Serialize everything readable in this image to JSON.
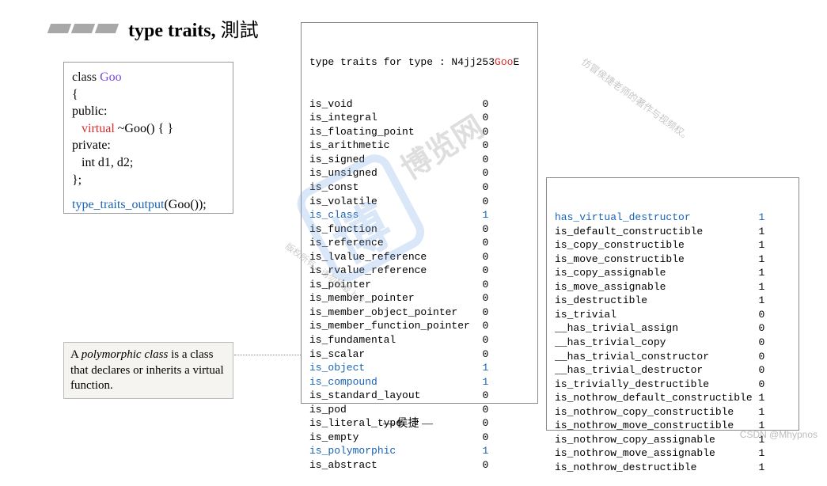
{
  "title": {
    "bold": "type traits,",
    "rest": " 測試"
  },
  "code_left": {
    "l1a": "class ",
    "l1b": "Goo",
    "l2": "{",
    "l3": "public:",
    "l4a": "virtual",
    "l4b": " ~Goo() {    }",
    "l5": "private:",
    "l6": "int d1, d2;",
    "l7": "};",
    "l8a": "type_traits_output",
    "l8b": "(Goo());"
  },
  "note": {
    "t1": "A ",
    "t2": "polymorphic class",
    "t3": " is a class that declares or inherits a virtual function."
  },
  "mid_header_a": "type traits for type : N4jj253",
  "mid_header_b": "Goo",
  "mid_header_c": "E",
  "mid": [
    {
      "k": "is_void",
      "v": "0",
      "hl": ""
    },
    {
      "k": "is_integral",
      "v": "0",
      "hl": ""
    },
    {
      "k": "is_floating_point",
      "v": "0",
      "hl": ""
    },
    {
      "k": "is_arithmetic",
      "v": "0",
      "hl": ""
    },
    {
      "k": "is_signed",
      "v": "0",
      "hl": ""
    },
    {
      "k": "is_unsigned",
      "v": "0",
      "hl": ""
    },
    {
      "k": "is_const",
      "v": "0",
      "hl": ""
    },
    {
      "k": "is_volatile",
      "v": "0",
      "hl": ""
    },
    {
      "k": "is_class",
      "v": "1",
      "hl": "blue"
    },
    {
      "k": "is_function",
      "v": "0",
      "hl": ""
    },
    {
      "k": "is_reference",
      "v": "0",
      "hl": ""
    },
    {
      "k": "is_lvalue_reference",
      "v": "0",
      "hl": ""
    },
    {
      "k": "is_rvalue_reference",
      "v": "0",
      "hl": ""
    },
    {
      "k": "is_pointer",
      "v": "0",
      "hl": ""
    },
    {
      "k": "is_member_pointer",
      "v": "0",
      "hl": ""
    },
    {
      "k": "is_member_object_pointer",
      "v": "0",
      "hl": ""
    },
    {
      "k": "is_member_function_pointer",
      "v": "0",
      "hl": ""
    },
    {
      "k": "is_fundamental",
      "v": "0",
      "hl": ""
    },
    {
      "k": "is_scalar",
      "v": "0",
      "hl": ""
    },
    {
      "k": "is_object",
      "v": "1",
      "hl": "blue"
    },
    {
      "k": "is_compound",
      "v": "1",
      "hl": "blue"
    },
    {
      "k": "is_standard_layout",
      "v": "0",
      "hl": ""
    },
    {
      "k": "is_pod",
      "v": "0",
      "hl": ""
    },
    {
      "k": "is_literal_type",
      "v": "0",
      "hl": ""
    },
    {
      "k": "is_empty",
      "v": "0",
      "hl": ""
    },
    {
      "k": "is_polymorphic",
      "v": "1",
      "hl": "blue"
    },
    {
      "k": "is_abstract",
      "v": "0",
      "hl": ""
    }
  ],
  "right": [
    {
      "k": "has_virtual_destructor",
      "v": "1",
      "hl": "blue"
    },
    {
      "k": "is_default_constructible",
      "v": "1",
      "hl": ""
    },
    {
      "k": "is_copy_constructible",
      "v": "1",
      "hl": ""
    },
    {
      "k": "is_move_constructible",
      "v": "1",
      "hl": ""
    },
    {
      "k": "is_copy_assignable",
      "v": "1",
      "hl": ""
    },
    {
      "k": "is_move_assignable",
      "v": "1",
      "hl": ""
    },
    {
      "k": "is_destructible",
      "v": "1",
      "hl": ""
    },
    {
      "k": "is_trivial",
      "v": "0",
      "hl": ""
    },
    {
      "k": "__has_trivial_assign",
      "v": "0",
      "hl": ""
    },
    {
      "k": "__has_trivial_copy",
      "v": "0",
      "hl": ""
    },
    {
      "k": "__has_trivial_constructor",
      "v": "0",
      "hl": ""
    },
    {
      "k": "__has_trivial_destructor",
      "v": "0",
      "hl": ""
    },
    {
      "k": "is_trivially_destructible",
      "v": "0",
      "hl": ""
    },
    {
      "k": "is_nothrow_default_constructible",
      "v": "1",
      "hl": ""
    },
    {
      "k": "is_nothrow_copy_constructible",
      "v": "1",
      "hl": ""
    },
    {
      "k": "is_nothrow_move_constructible",
      "v": "1",
      "hl": ""
    },
    {
      "k": "is_nothrow_copy_assignable",
      "v": "1",
      "hl": ""
    },
    {
      "k": "is_nothrow_move_assignable",
      "v": "1",
      "hl": ""
    },
    {
      "k": "is_nothrow_destructible",
      "v": "1",
      "hl": ""
    }
  ],
  "author": "— 侯捷 —",
  "csdn": "CSDN @Mhypnos",
  "wm_boke": "博览网",
  "wm_small1": "仿冒侯捷老师的著作与视频权。",
  "wm_small2": "版权所有，请勿转载上传"
}
